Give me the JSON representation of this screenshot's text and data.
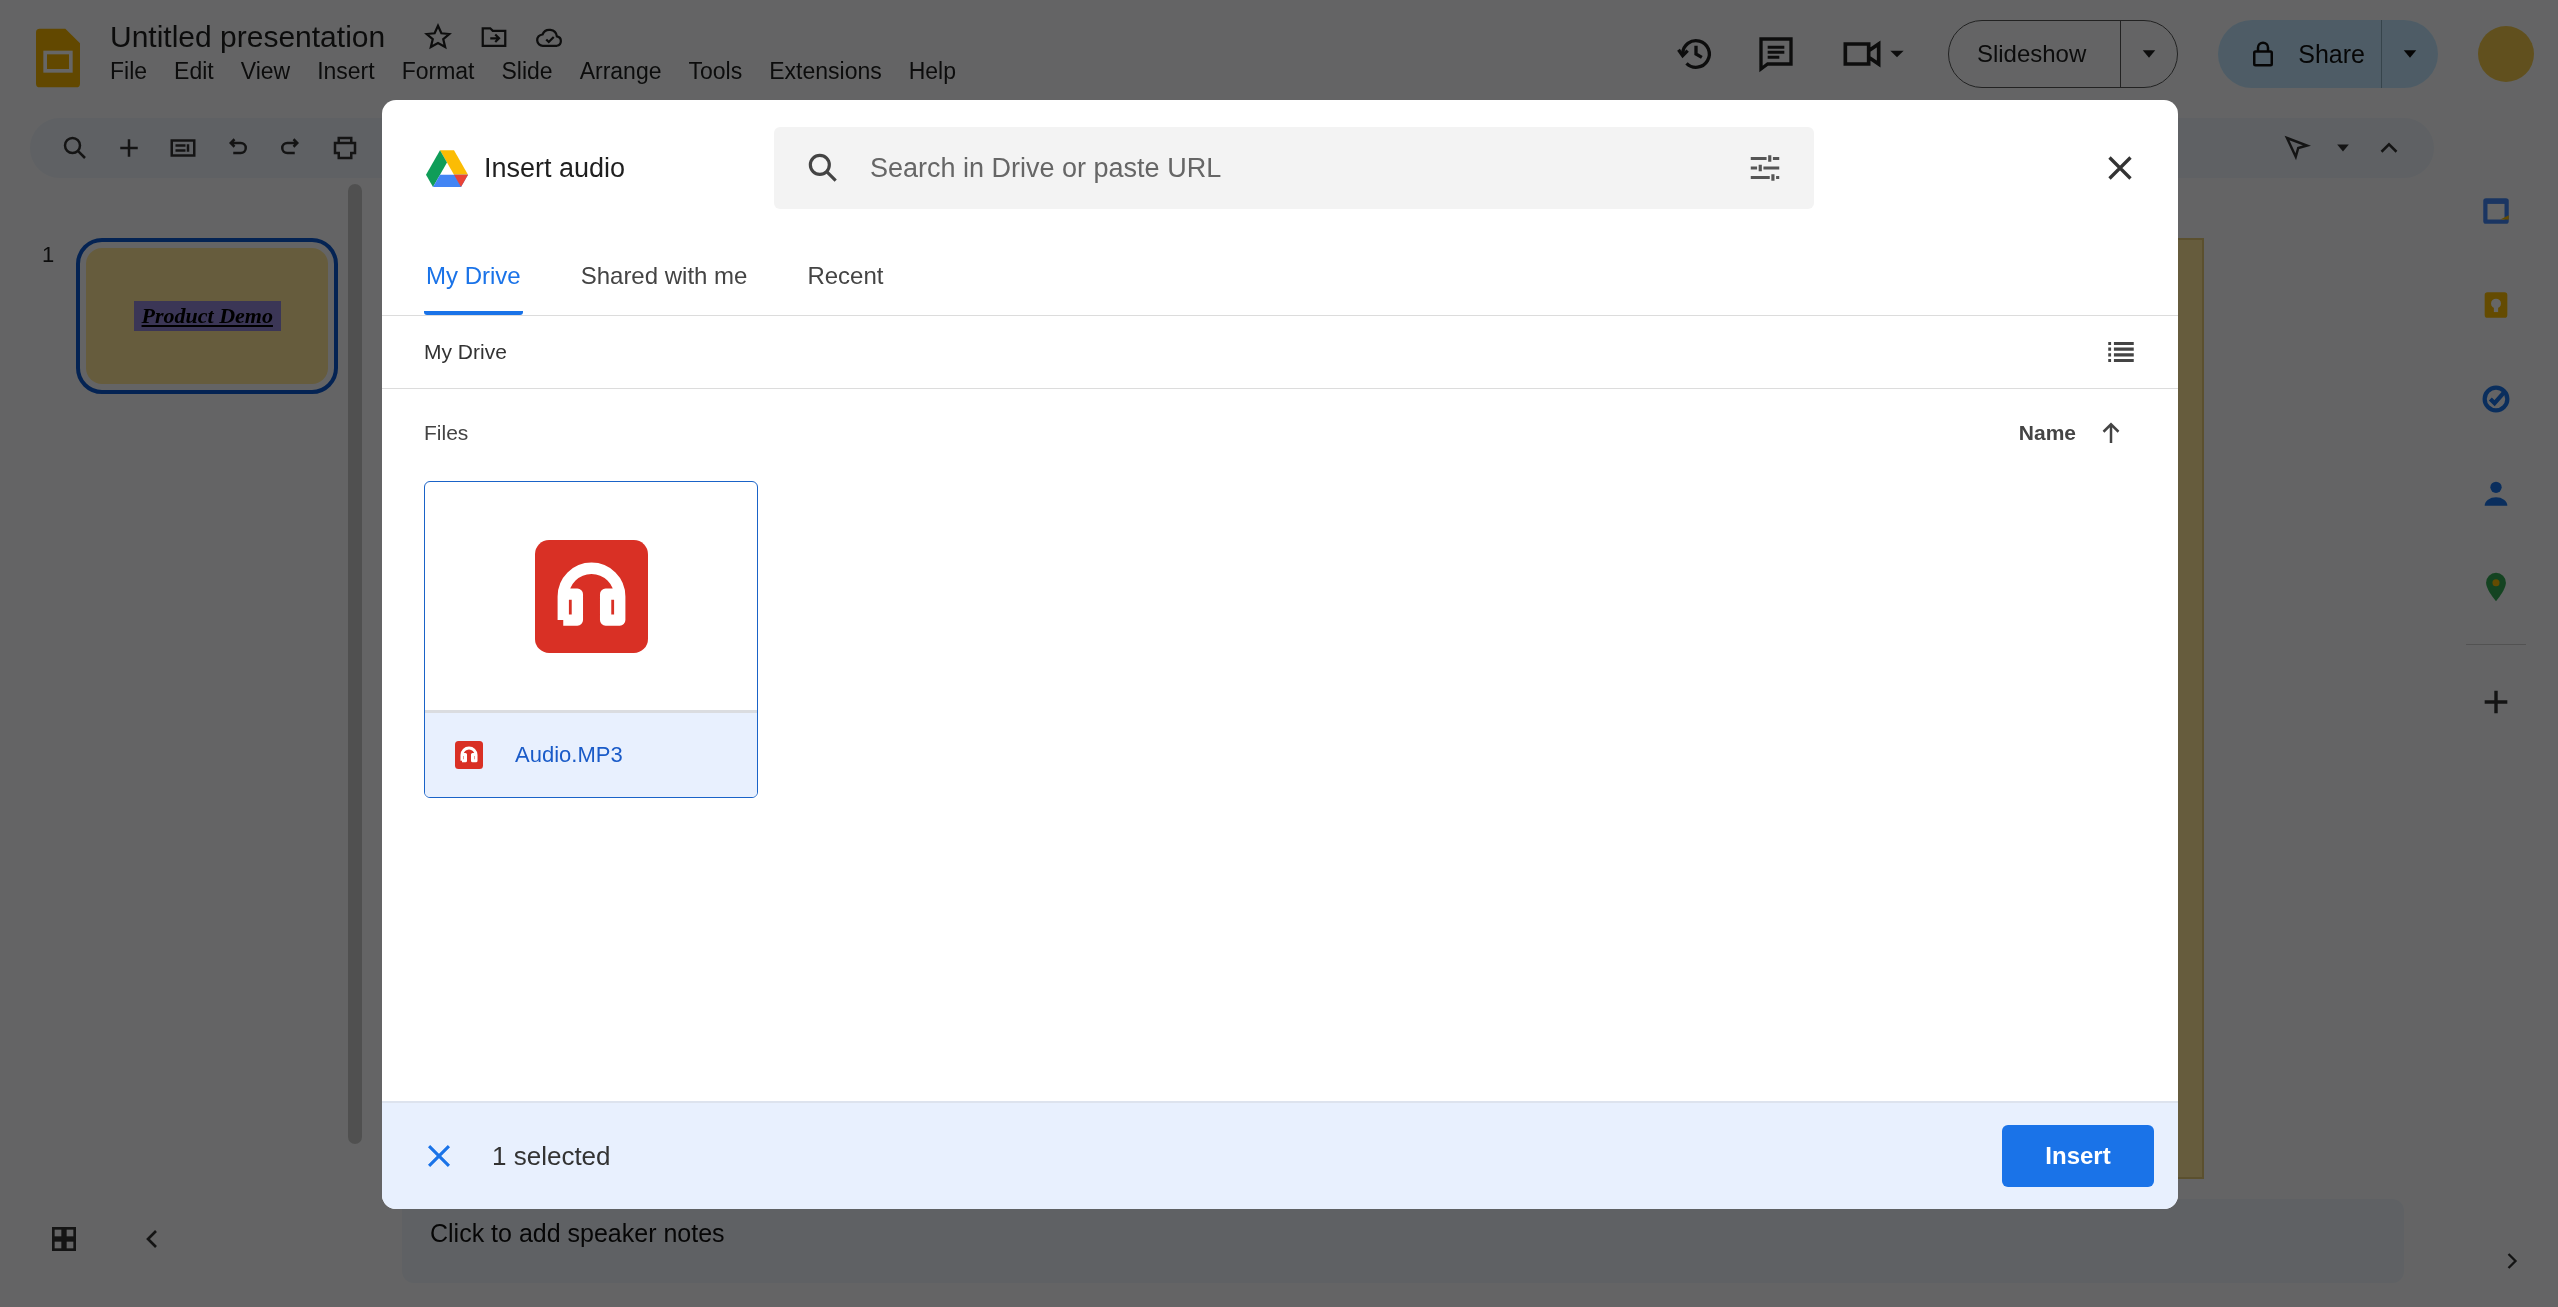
{
  "app": {
    "title": "Untitled presentation",
    "menu": [
      "File",
      "Edit",
      "View",
      "Insert",
      "Format",
      "Slide",
      "Arrange",
      "Tools",
      "Extensions",
      "Help"
    ],
    "slideshow_button": "Slideshow",
    "share_button": "Share",
    "slides": [
      {
        "number": "1",
        "title": "Product Demo",
        "selected": true
      }
    ],
    "speaker_notes_prompt": "Click to add speaker notes"
  },
  "dialog": {
    "title": "Insert audio",
    "search": {
      "placeholder": "Search in Drive or paste URL"
    },
    "tabs": [
      {
        "label": "My Drive",
        "selected": true
      },
      {
        "label": "Shared with me",
        "selected": false
      },
      {
        "label": "Recent",
        "selected": false
      }
    ],
    "breadcrumb": "My Drive",
    "section_label": "Files",
    "sort_label": "Name",
    "files": [
      {
        "name": "Audio.MP3",
        "selected": true
      }
    ],
    "selection_text": "1 selected",
    "insert_button": "Insert"
  }
}
